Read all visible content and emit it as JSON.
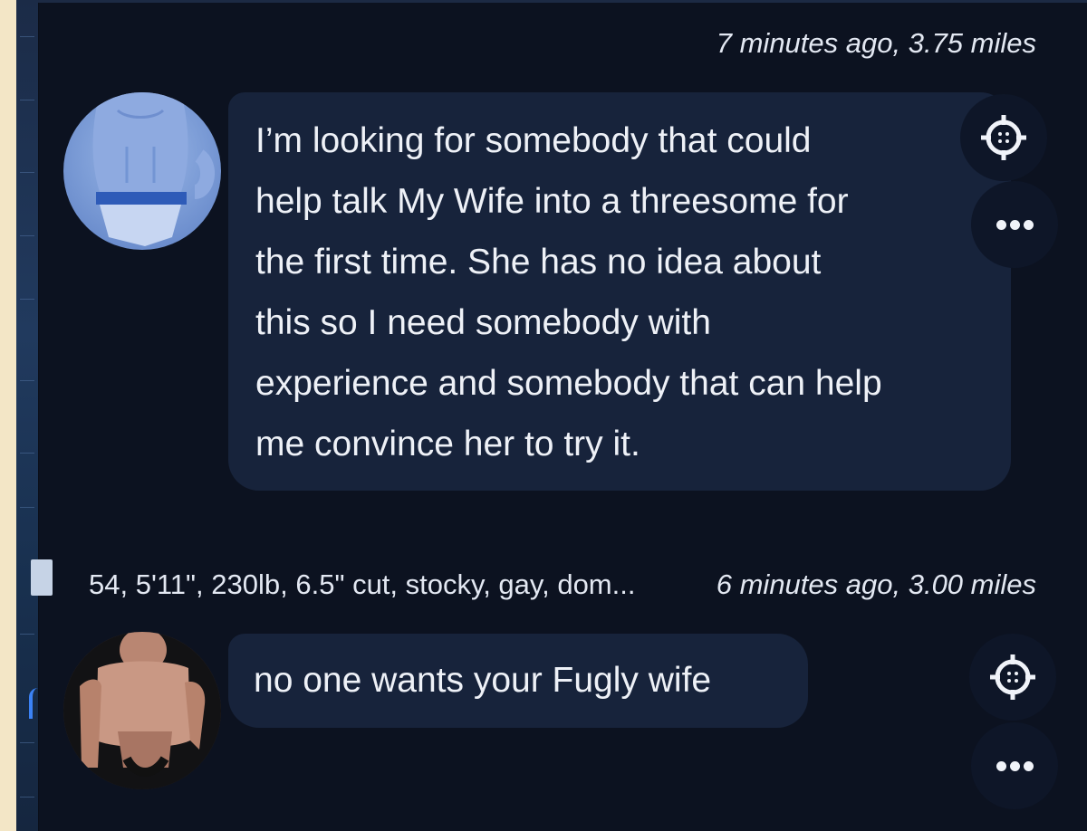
{
  "messages": [
    {
      "meta_time": "7 minutes ago, 3.75 miles",
      "profile_summary": "",
      "lines": [
        "I’m looking for somebody that could",
        "help talk My Wife into a threesome for",
        "the first time. She has no idea about",
        "this so I need somebody with",
        "experience and somebody that can help",
        "me convince her to try it."
      ],
      "icons": [
        "locate-icon",
        "more-options-icon"
      ]
    },
    {
      "meta_time": "6 minutes ago, 3.00 miles",
      "profile_summary": "54, 5'11\", 230lb, 6.5\" cut, stocky, gay, dom...",
      "text": "no one wants your Fugly wife",
      "icons": [
        "locate-icon",
        "more-options-icon"
      ]
    }
  ],
  "colors": {
    "background": "#0c1220",
    "bubble": "#17233b",
    "text": "#eef1f7"
  }
}
